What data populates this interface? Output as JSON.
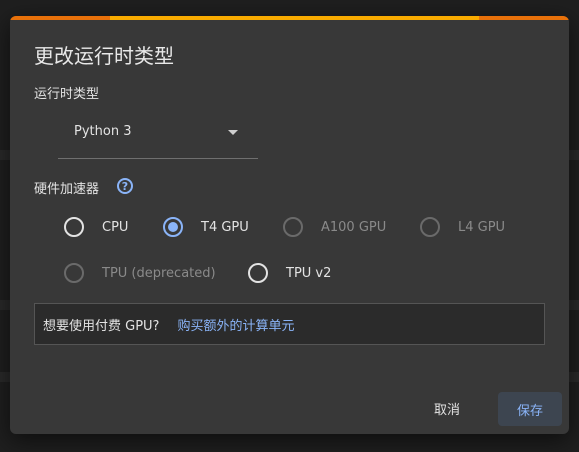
{
  "dialog": {
    "title": "更改运行时类型",
    "runtime_type_label": "运行时类型",
    "runtime_select": {
      "value": "Python 3"
    },
    "accelerator_label": "硬件加速器",
    "help_icon_glyph": "?",
    "accelerators": [
      {
        "label": "CPU",
        "checked": false,
        "disabled": false
      },
      {
        "label": "T4 GPU",
        "checked": true,
        "disabled": false
      },
      {
        "label": "A100 GPU",
        "checked": false,
        "disabled": true
      },
      {
        "label": "L4 GPU",
        "checked": false,
        "disabled": true
      },
      {
        "label": "TPU (deprecated)",
        "checked": false,
        "disabled": true
      },
      {
        "label": "TPU v2",
        "checked": false,
        "disabled": false
      }
    ],
    "promo": {
      "text": "想要使用付费 GPU?",
      "link": "购买额外的计算单元"
    },
    "buttons": {
      "cancel": "取消",
      "save": "保存"
    }
  },
  "colors": {
    "accent": "#8ab4f8",
    "progress_orange": "#e8710a",
    "progress_yellow": "#f9ab00",
    "dialog_bg": "#383838"
  }
}
